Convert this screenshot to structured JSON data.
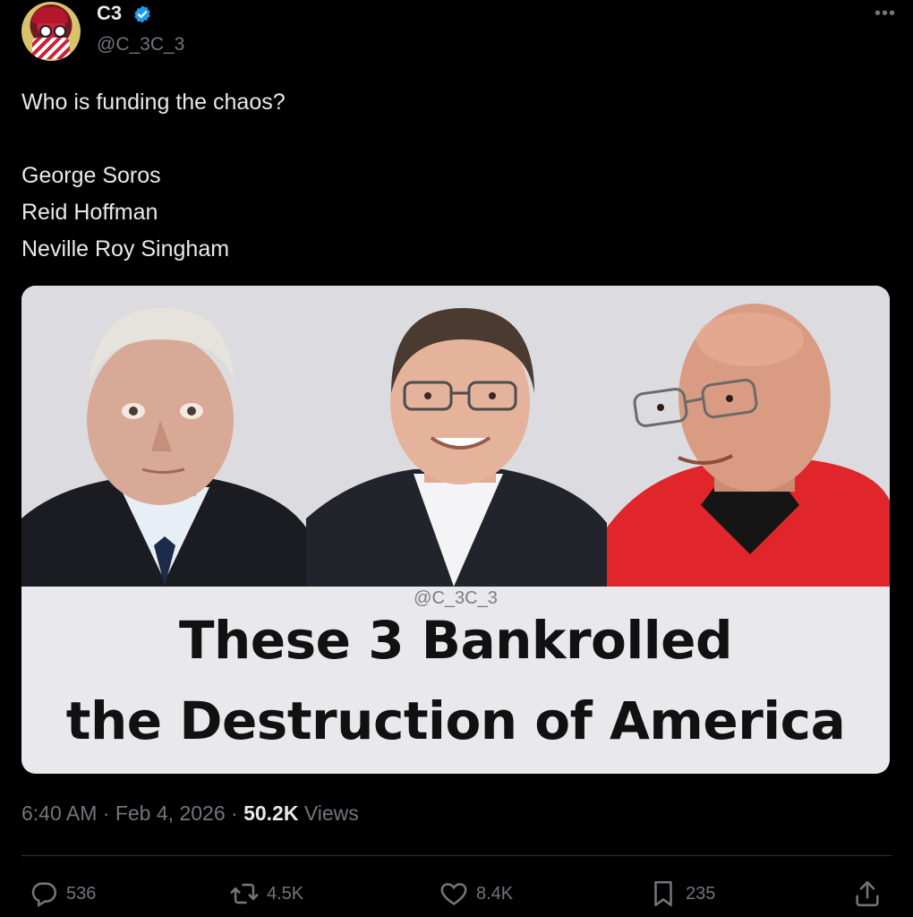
{
  "author": {
    "display_name": "C3",
    "handle": "@C_3C_3",
    "verified": true
  },
  "menu_icon": "more-horizontal-icon",
  "tweet": {
    "lines": [
      "Who is funding the chaos?",
      "",
      "George Soros",
      "Reid Hoffman",
      "Neville Roy Singham"
    ]
  },
  "media": {
    "watermark": "@C_3C_3",
    "headline_line1": "These 3 Bankrolled",
    "headline_line2": "the Destruction of America"
  },
  "meta": {
    "time": "6:40 AM",
    "separator": "·",
    "date": "Feb 4, 2026",
    "views_count": "50.2K",
    "views_label": "Views"
  },
  "actions": {
    "replies": "536",
    "reposts": "4.5K",
    "likes": "8.4K",
    "bookmarks": "235"
  },
  "colors": {
    "background": "#000000",
    "text_primary": "#e7e9ea",
    "text_secondary": "#71767b",
    "verified_blue": "#1d9bf0",
    "divider": "#2f3336"
  }
}
